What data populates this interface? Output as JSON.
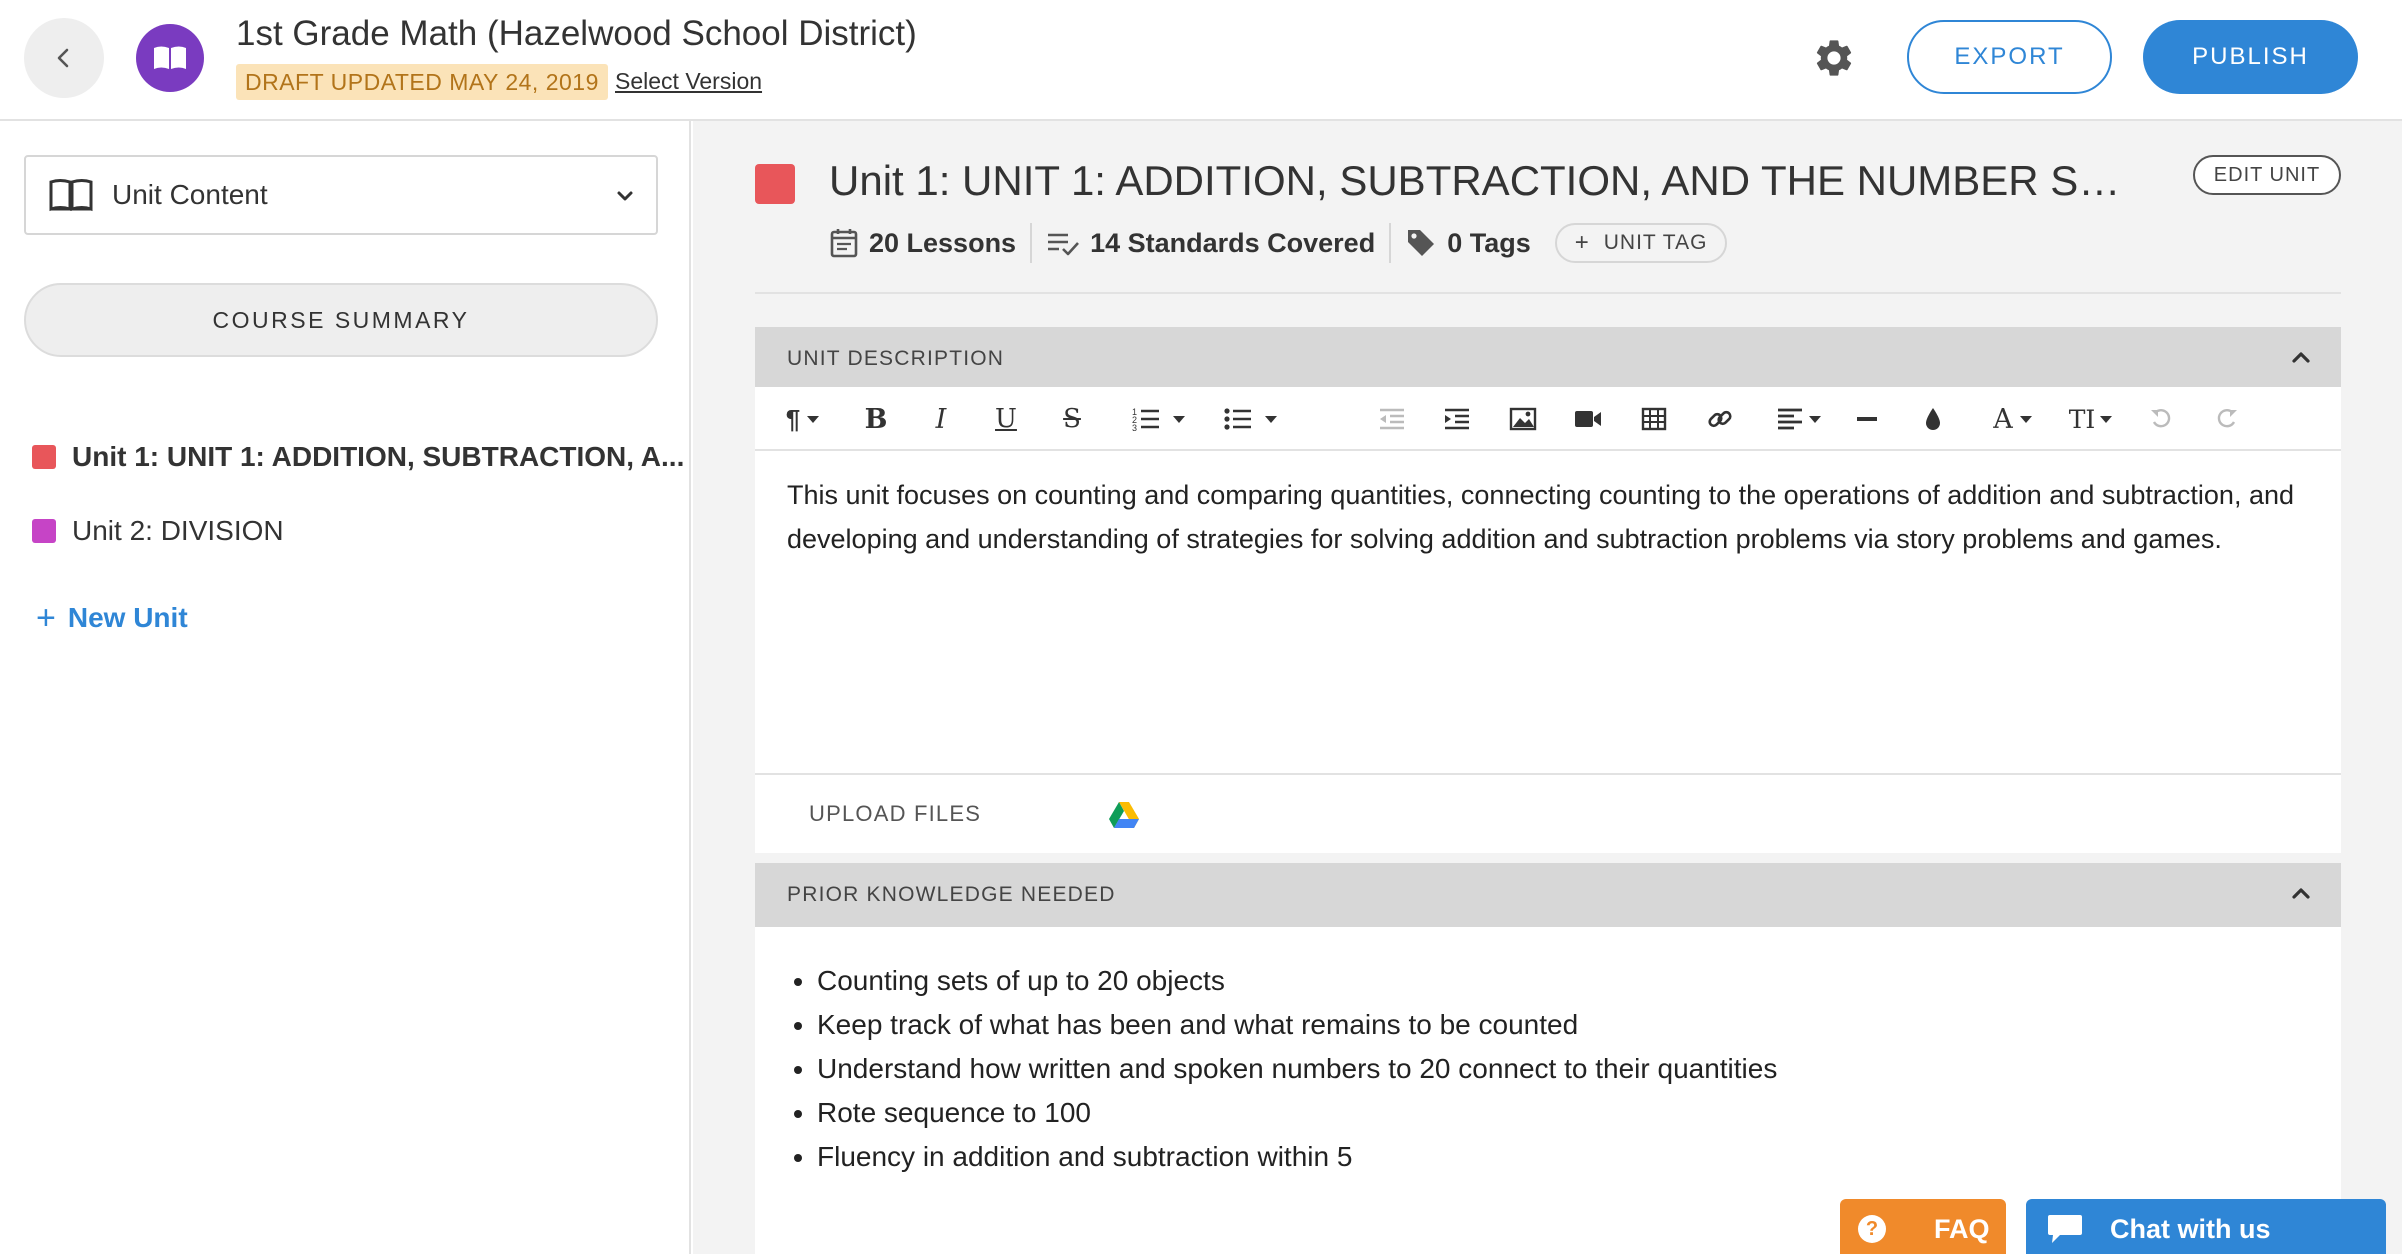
{
  "header": {
    "course_title": "1st Grade Math (Hazelwood School District)",
    "draft_status": "DRAFT UPDATED MAY 24, 2019",
    "select_version": "Select Version",
    "export_label": "EXPORT",
    "publish_label": "PUBLISH"
  },
  "sidebar": {
    "view_select": "Unit Content",
    "course_summary": "COURSE SUMMARY",
    "units": [
      {
        "label": "Unit 1: UNIT 1: ADDITION, SUBTRACTION, A...",
        "color": "#e8565a",
        "active": true
      },
      {
        "label": "Unit 2: DIVISION",
        "color": "#c644c6",
        "active": false
      }
    ],
    "new_unit": "New Unit"
  },
  "unit": {
    "title": "Unit 1: UNIT 1: ADDITION, SUBTRACTION, AND THE NUMBER SYS...",
    "color": "#e8565a",
    "edit_label": "EDIT UNIT",
    "lessons": "20 Lessons",
    "standards": "14 Standards Covered",
    "tags": "0 Tags",
    "unit_tag": "UNIT TAG"
  },
  "description": {
    "heading": "UNIT DESCRIPTION",
    "text": "This unit focuses on counting and comparing quantities, connecting counting to the operations of addition and subtraction, and developing and understanding of strategies for solving addition and subtraction problems via story problems and games.",
    "upload_files": "UPLOAD FILES"
  },
  "toolbar": {
    "paragraph": "¶",
    "bold": "B",
    "italic": "I",
    "underline": "U",
    "strike": "S",
    "font_color": "A",
    "font_size": "TI"
  },
  "prior_knowledge": {
    "heading": "PRIOR KNOWLEDGE NEEDED",
    "items": [
      "Counting sets of up to 20 objects",
      "Keep track of what has been and what remains to be counted",
      "Understand how written and spoken numbers to 20 connect to their quantities",
      "Rote sequence to 100",
      "Fluency in addition and subtraction within 5"
    ]
  },
  "support": {
    "faq": "FAQ",
    "chat": "Chat with us"
  },
  "colors": {
    "accent": "#2f86d6",
    "course_badge": "#7a3bc0",
    "faq": "#f08a2b",
    "draft_bg": "#fbe3b8"
  }
}
